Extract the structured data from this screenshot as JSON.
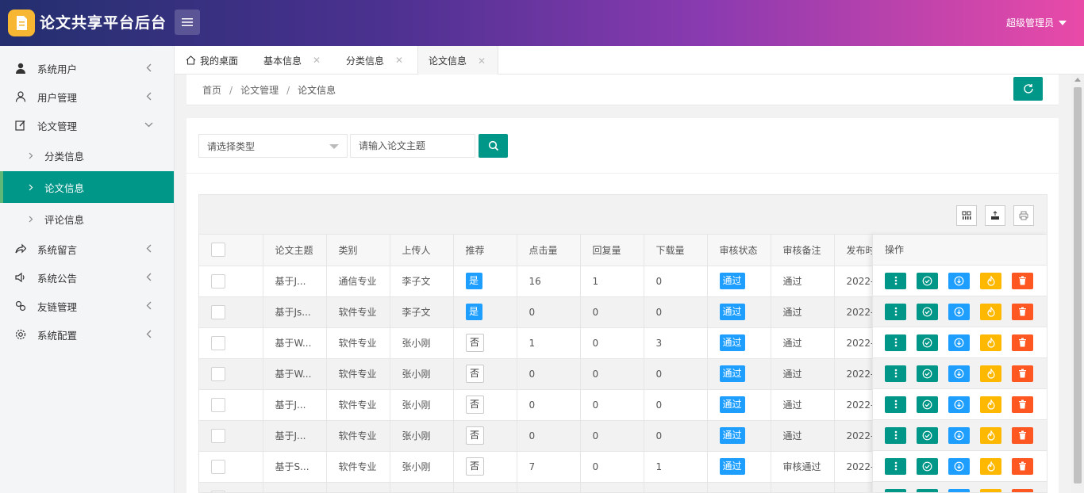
{
  "app": {
    "title": "论文共享平台后台",
    "user": "超级管理员"
  },
  "sidebar": {
    "items": [
      {
        "label": "系统用户",
        "icon": "user-filled-icon"
      },
      {
        "label": "用户管理",
        "icon": "user-outline-icon"
      },
      {
        "label": "论文管理",
        "icon": "edit-icon",
        "expanded": true,
        "children": [
          {
            "label": "分类信息"
          },
          {
            "label": "论文信息",
            "active": true
          },
          {
            "label": "评论信息"
          }
        ]
      },
      {
        "label": "系统留言",
        "icon": "share-icon"
      },
      {
        "label": "系统公告",
        "icon": "speaker-icon"
      },
      {
        "label": "友链管理",
        "icon": "link-icon"
      },
      {
        "label": "系统配置",
        "icon": "gear-icon"
      }
    ]
  },
  "tabs": [
    {
      "label": "我的桌面"
    },
    {
      "label": "基本信息"
    },
    {
      "label": "分类信息"
    },
    {
      "label": "论文信息",
      "active": true
    }
  ],
  "breadcrumb": [
    "首页",
    "论文管理",
    "论文信息"
  ],
  "search": {
    "select_placeholder": "请选择类型",
    "input_placeholder": "请输入论文主题"
  },
  "table": {
    "headers": [
      "论文主题",
      "类别",
      "上传人",
      "推荐",
      "点击量",
      "回复量",
      "下载量",
      "审核状态",
      "审核备注",
      "发布时"
    ],
    "ops_header": "操作",
    "rows": [
      {
        "title": "基于J...",
        "category": "通信专业",
        "uploader": "李子文",
        "recommend": "是",
        "clicks": "16",
        "replies": "1",
        "downloads": "0",
        "status": "通过",
        "note": "通过",
        "date": "2022-"
      },
      {
        "title": "基于Js...",
        "category": "软件专业",
        "uploader": "李子文",
        "recommend": "是",
        "clicks": "0",
        "replies": "0",
        "downloads": "0",
        "status": "通过",
        "note": "通过",
        "date": "2022-"
      },
      {
        "title": "基于W...",
        "category": "软件专业",
        "uploader": "张小刚",
        "recommend": "否",
        "clicks": "1",
        "replies": "0",
        "downloads": "3",
        "status": "通过",
        "note": "通过",
        "date": "2022-"
      },
      {
        "title": "基于W...",
        "category": "软件专业",
        "uploader": "张小刚",
        "recommend": "否",
        "clicks": "0",
        "replies": "0",
        "downloads": "0",
        "status": "通过",
        "note": "通过",
        "date": "2022-"
      },
      {
        "title": "基于J...",
        "category": "软件专业",
        "uploader": "张小刚",
        "recommend": "否",
        "clicks": "0",
        "replies": "0",
        "downloads": "0",
        "status": "通过",
        "note": "通过",
        "date": "2022-"
      },
      {
        "title": "基于J...",
        "category": "软件专业",
        "uploader": "张小刚",
        "recommend": "否",
        "clicks": "0",
        "replies": "0",
        "downloads": "0",
        "status": "通过",
        "note": "通过",
        "date": "2022-"
      },
      {
        "title": "基于S...",
        "category": "软件专业",
        "uploader": "张小刚",
        "recommend": "否",
        "clicks": "7",
        "replies": "0",
        "downloads": "1",
        "status": "通过",
        "note": "审核通过",
        "date": "2022-"
      }
    ]
  },
  "colors": {
    "primary": "#009688",
    "blue": "#1e9fff",
    "orange": "#ffb800",
    "red": "#ff5722"
  }
}
